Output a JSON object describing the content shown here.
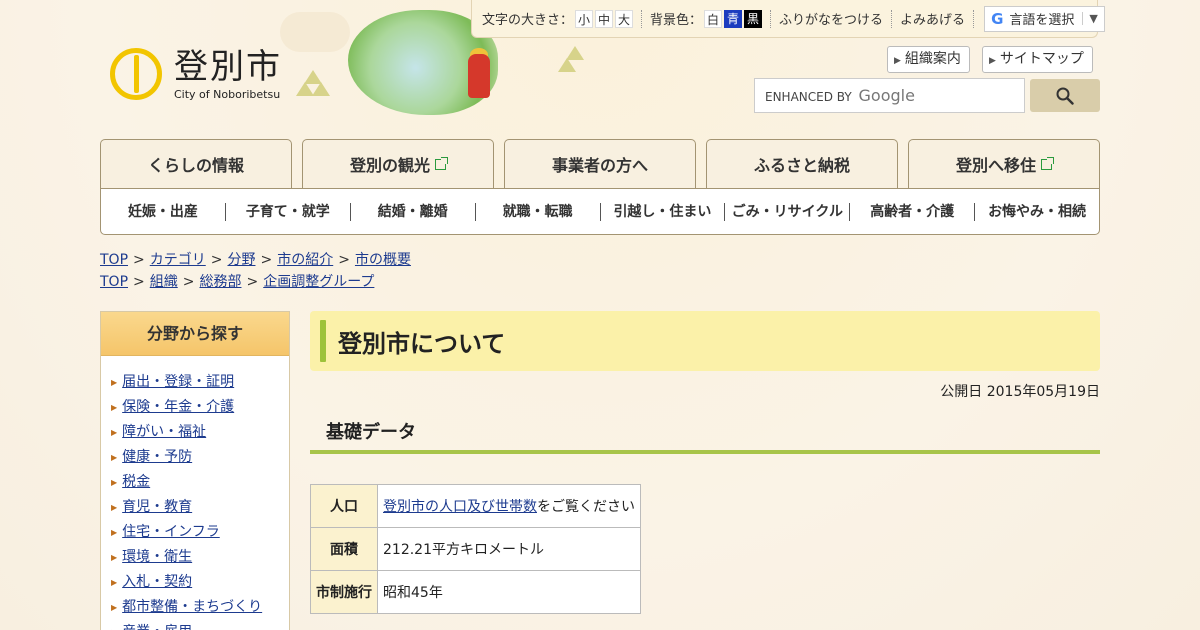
{
  "utility": {
    "font_size_label": "文字の大きさ：",
    "size_small": "小",
    "size_medium": "中",
    "size_large": "大",
    "bg_color_label": "背景色：",
    "bg_white": "白",
    "bg_blue": "青",
    "bg_black": "黒",
    "furigana": "ふりがなをつける",
    "read_aloud": "よみあげる",
    "language_select": "言語を選択",
    "language_arrow": "▼"
  },
  "logo": {
    "name_jp": "登別市",
    "name_en": "City of Noboribetsu"
  },
  "header_links": {
    "org": "組織案内",
    "sitemap": "サイトマップ"
  },
  "search": {
    "branding": "ENHANCED BY",
    "google": "Google"
  },
  "main_nav": [
    {
      "label": "くらしの情報",
      "external": false
    },
    {
      "label": "登別の観光",
      "external": true
    },
    {
      "label": "事業者の方へ",
      "external": false
    },
    {
      "label": "ふるさと納税",
      "external": false
    },
    {
      "label": "登別へ移住",
      "external": true
    }
  ],
  "sub_nav": [
    "妊娠・出産",
    "子育て・就学",
    "結婚・離婚",
    "就職・転職",
    "引越し・住まい",
    "ごみ・リサイクル",
    "高齢者・介護",
    "お悔やみ・相続"
  ],
  "breadcrumbs": [
    [
      "TOP",
      "カテゴリ",
      "分野",
      "市の紹介",
      "市の概要"
    ],
    [
      "TOP",
      "組織",
      "総務部",
      "企画調整グループ"
    ]
  ],
  "breadcrumb_sep": ">",
  "sidebar": {
    "heading": "分野から探す",
    "items": [
      "届出・登録・証明",
      "保険・年金・介護",
      "障がい・福祉",
      "健康・予防",
      "税金",
      "育児・教育",
      "住宅・インフラ",
      "環境・衛生",
      "入札・契約",
      "都市整備・まちづくり",
      "産業・雇用"
    ]
  },
  "page": {
    "title": "登別市について",
    "published": "公開日 2015年05月19日",
    "section": "基礎データ"
  },
  "table": [
    {
      "head": "人口",
      "link": "登別市の人口及び世帯数",
      "rest": "をご覧ください"
    },
    {
      "head": "面積",
      "value": "212.21平方キロメートル"
    },
    {
      "head": "市制施行",
      "value": "昭和45年"
    }
  ],
  "colors": {
    "accent_green": "#a7c449",
    "title_bg": "#fbf1a9",
    "link": "#1d3b8f",
    "logo_yellow": "#f2c500"
  }
}
